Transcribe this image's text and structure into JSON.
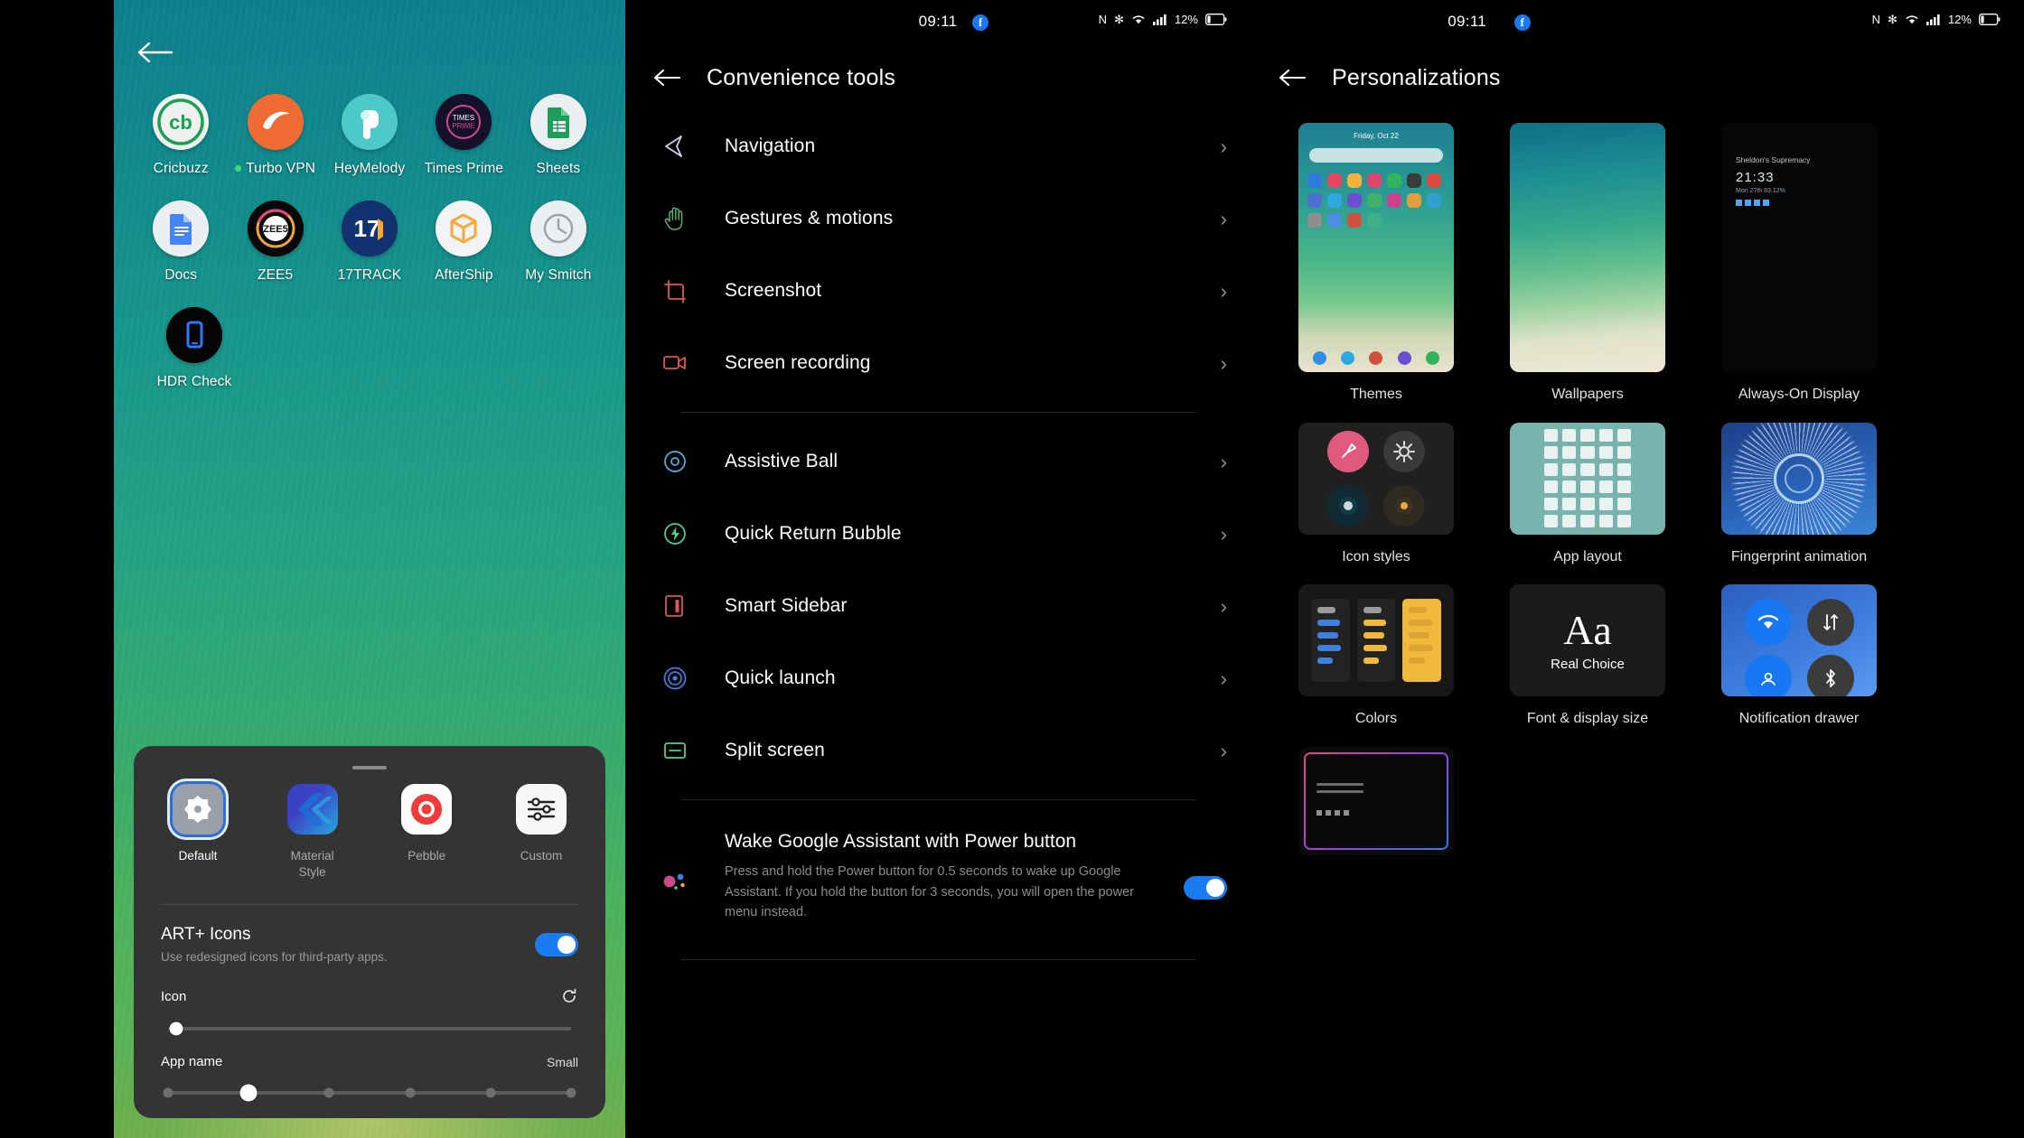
{
  "home": {
    "back_icon": "back-arrow-icon",
    "apps": [
      [
        {
          "label": "Cricbuzz",
          "icon": "cricbuzz-icon",
          "dot": false
        },
        {
          "label": "Turbo VPN",
          "icon": "turbovpn-icon",
          "dot": true
        },
        {
          "label": "HeyMelody",
          "icon": "heymelody-icon",
          "dot": false
        },
        {
          "label": "Times Prime",
          "icon": "timesprime-icon",
          "dot": false
        },
        {
          "label": "Sheets",
          "icon": "google-sheets-icon",
          "dot": false
        }
      ],
      [
        {
          "label": "Docs",
          "icon": "google-docs-icon",
          "dot": false
        },
        {
          "label": "ZEE5",
          "icon": "zee5-icon",
          "dot": false
        },
        {
          "label": "17TRACK",
          "icon": "17track-icon",
          "dot": false
        },
        {
          "label": "AfterShip",
          "icon": "aftership-icon",
          "dot": false
        },
        {
          "label": "My Smitch",
          "icon": "mysmitch-icon",
          "dot": false
        }
      ],
      [
        {
          "label": "HDR Check",
          "icon": "hdrcheck-icon",
          "dot": false
        }
      ]
    ],
    "sheet": {
      "styles": [
        {
          "label": "Default",
          "selected": true,
          "icon": "default-style-icon"
        },
        {
          "label": "Material Style",
          "selected": false,
          "icon": "material-style-icon"
        },
        {
          "label": "Pebble",
          "selected": false,
          "icon": "pebble-style-icon"
        },
        {
          "label": "Custom",
          "selected": false,
          "icon": "custom-style-icon"
        }
      ],
      "art_icons": {
        "title": "ART+ Icons",
        "subtitle": "Use redesigned icons for third-party apps.",
        "enabled": true
      },
      "icon_slider": {
        "label": "Icon",
        "value_pct": 2,
        "reset_icon": "reset-icon"
      },
      "appname_slider": {
        "label": "App name",
        "value_label": "Small",
        "steps": 5,
        "selected_index": 1
      }
    }
  },
  "convenience": {
    "status": {
      "time": "09:11",
      "fb_badge": "f",
      "icons": [
        "nfc-icon",
        "bluetooth-icon",
        "wifi-icon",
        "signal-icon"
      ],
      "battery_pct": "12%"
    },
    "back_icon": "back-arrow-icon",
    "title": "Convenience tools",
    "groups": [
      [
        {
          "label": "Navigation",
          "icon": "navigation-icon",
          "color": "#cfd2e8",
          "chevron": "chevron-right-icon"
        },
        {
          "label": "Gestures & motions",
          "icon": "hand-gesture-icon",
          "color": "#5fae6e",
          "chevron": "chevron-right-icon"
        },
        {
          "label": "Screenshot",
          "icon": "screenshot-icon",
          "color": "#e0564f",
          "chevron": "chevron-right-icon"
        },
        {
          "label": "Screen recording",
          "icon": "screen-recording-icon",
          "color": "#e0564f",
          "chevron": "chevron-right-icon"
        }
      ],
      [
        {
          "label": "Assistive Ball",
          "icon": "assistive-ball-icon",
          "color": "#4fb3e8",
          "chevron": "chevron-right-icon"
        },
        {
          "label": "Quick Return Bubble",
          "icon": "quick-return-bubble-icon",
          "color": "#4fd18a",
          "chevron": "chevron-right-icon"
        },
        {
          "label": "Smart Sidebar",
          "icon": "smart-sidebar-icon",
          "color": "#e0564f",
          "chevron": "chevron-right-icon"
        },
        {
          "label": "Quick launch",
          "icon": "quick-launch-icon",
          "color": "#3f7fe0",
          "chevron": "chevron-right-icon"
        },
        {
          "label": "Split screen",
          "icon": "split-screen-icon",
          "color": "#4fd18a",
          "chevron": "chevron-right-icon"
        }
      ]
    ],
    "wake_assistant": {
      "icon": "google-assistant-icon",
      "title": "Wake Google Assistant with Power button",
      "description": "Press and hold the Power button for 0.5 seconds to wake up Google Assistant. If you hold the button for 3 seconds, you will open the power menu instead.",
      "enabled": true
    }
  },
  "personalizations": {
    "status": {
      "time": "09:11",
      "fb_badge": "f",
      "icons": [
        "nfc-icon",
        "bluetooth-icon",
        "wifi-icon",
        "signal-icon"
      ],
      "battery_pct": "12%"
    },
    "back_icon": "back-arrow-icon",
    "title": "Personalizations",
    "items": [
      {
        "label": "Themes",
        "thumb": "themes-thumb",
        "date": "Friday, Oct 22"
      },
      {
        "label": "Wallpapers",
        "thumb": "wallpapers-thumb"
      },
      {
        "label": "Always-On Display",
        "thumb": "aod-thumb",
        "aod_title": "Sheldon's Supremacy",
        "aod_clock": "21:33",
        "aod_date": "Mon 27th 83.12%"
      },
      {
        "label": "Icon styles",
        "thumb": "icon-styles-thumb"
      },
      {
        "label": "App layout",
        "thumb": "app-layout-thumb"
      },
      {
        "label": "Fingerprint animation",
        "thumb": "fingerprint-animation-thumb"
      },
      {
        "label": "Colors",
        "thumb": "colors-thumb"
      },
      {
        "label": "Font & display size",
        "thumb": "font-display-size-thumb",
        "aa": "Aa",
        "real": "Real Choice"
      },
      {
        "label": "Notification drawer",
        "thumb": "notification-drawer-thumb"
      },
      {
        "label": "",
        "thumb": "edge-lighting-thumb"
      }
    ]
  }
}
